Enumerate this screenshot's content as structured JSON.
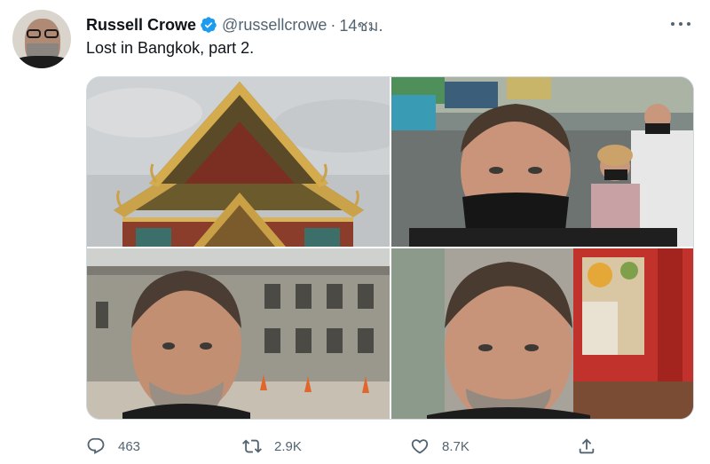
{
  "tweet": {
    "author": {
      "name": "Russell Crowe",
      "handle": "@russellcrowe",
      "verified": true
    },
    "separator": "·",
    "time": "14ชม.",
    "text": "Lost in Bangkok, part 2.",
    "media": [
      {
        "kind": "photo",
        "subject": "temple-roof"
      },
      {
        "kind": "photo",
        "subject": "street-selfie"
      },
      {
        "kind": "photo",
        "subject": "old-building-selfie"
      },
      {
        "kind": "photo",
        "subject": "shrine-selfie"
      }
    ],
    "actions": {
      "reply_count": "463",
      "retweet_count": "2.9K",
      "like_count": "8.7K"
    },
    "icons": {
      "more": "more-horizontal-icon",
      "reply": "reply-icon",
      "retweet": "retweet-icon",
      "like": "heart-icon",
      "share": "share-icon",
      "verified": "verified-badge-icon"
    },
    "colors": {
      "verified": "#1d9bf0",
      "secondary_text": "#536471",
      "primary_text": "#0f1419",
      "border": "#cfd9de"
    }
  }
}
